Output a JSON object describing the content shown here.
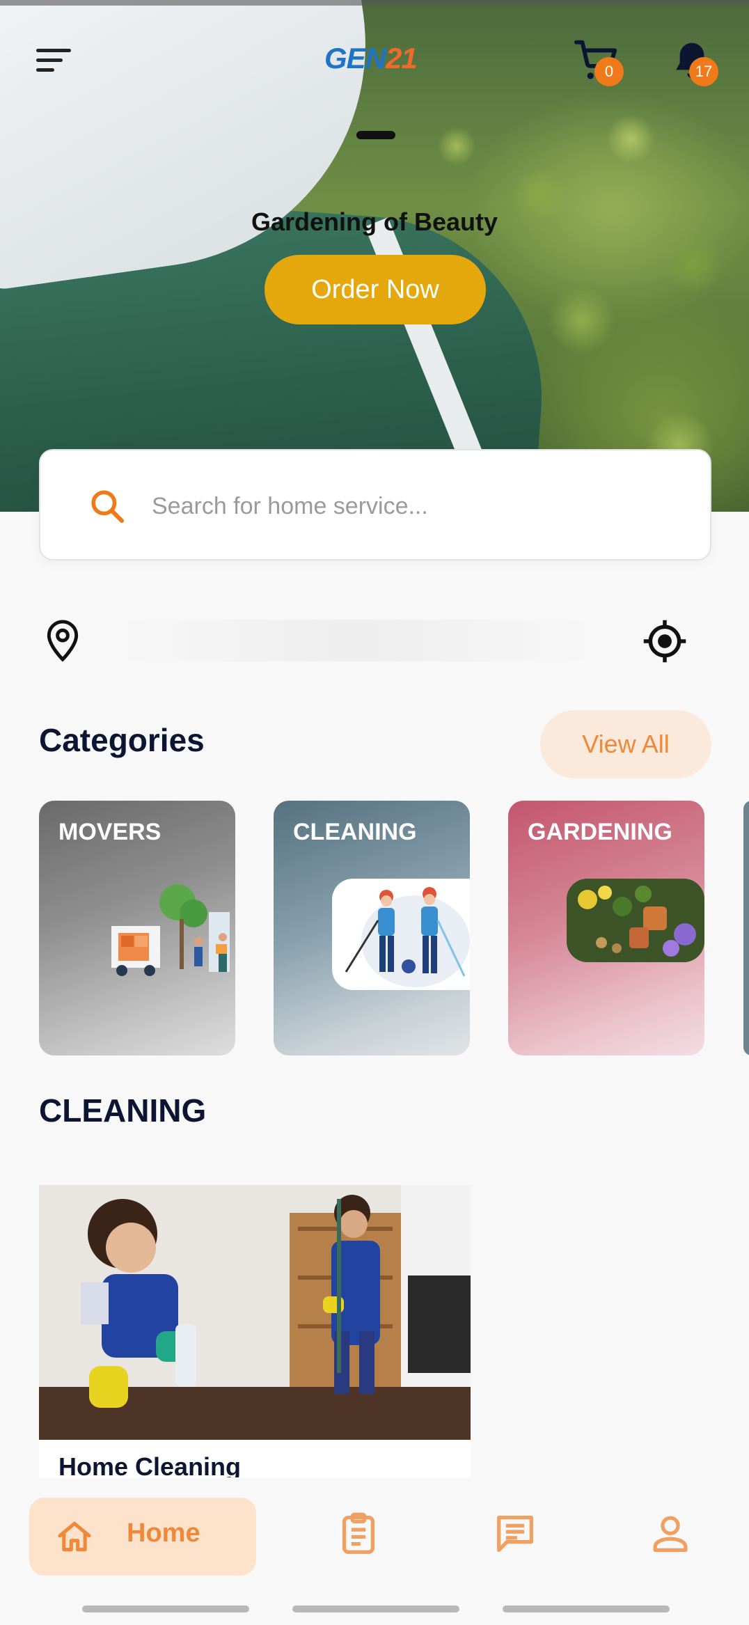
{
  "header": {
    "logo_part1": "GEN",
    "logo_part2": "21",
    "cart_count": "0",
    "notification_count": "17",
    "icons": [
      "menu-icon",
      "cart-icon",
      "bell-icon"
    ]
  },
  "hero": {
    "title": "Gardening of Beauty",
    "cta_label": "Order Now"
  },
  "search": {
    "placeholder": "Search for home service..."
  },
  "location": {
    "icons": [
      "location-pin-icon",
      "crosshair-icon"
    ]
  },
  "categories": {
    "title": "Categories",
    "view_all_label": "View All",
    "items": [
      {
        "label": "MOVERS"
      },
      {
        "label": "CLEANING"
      },
      {
        "label": "GARDENING"
      }
    ]
  },
  "cleaning_section": {
    "title": "CLEANING",
    "cards": [
      {
        "name": "Home Cleaning"
      }
    ]
  },
  "bottom_nav": {
    "home_label": "Home",
    "icons": [
      "home-icon",
      "orders-icon",
      "chat-icon",
      "profile-icon"
    ]
  },
  "colors": {
    "accent_orange": "#f07a1a",
    "cta_gold": "#e4a80c",
    "heading_navy": "#0c1633",
    "view_all_bg": "#fbeadb",
    "home_tab_bg": "#fde3cc"
  }
}
